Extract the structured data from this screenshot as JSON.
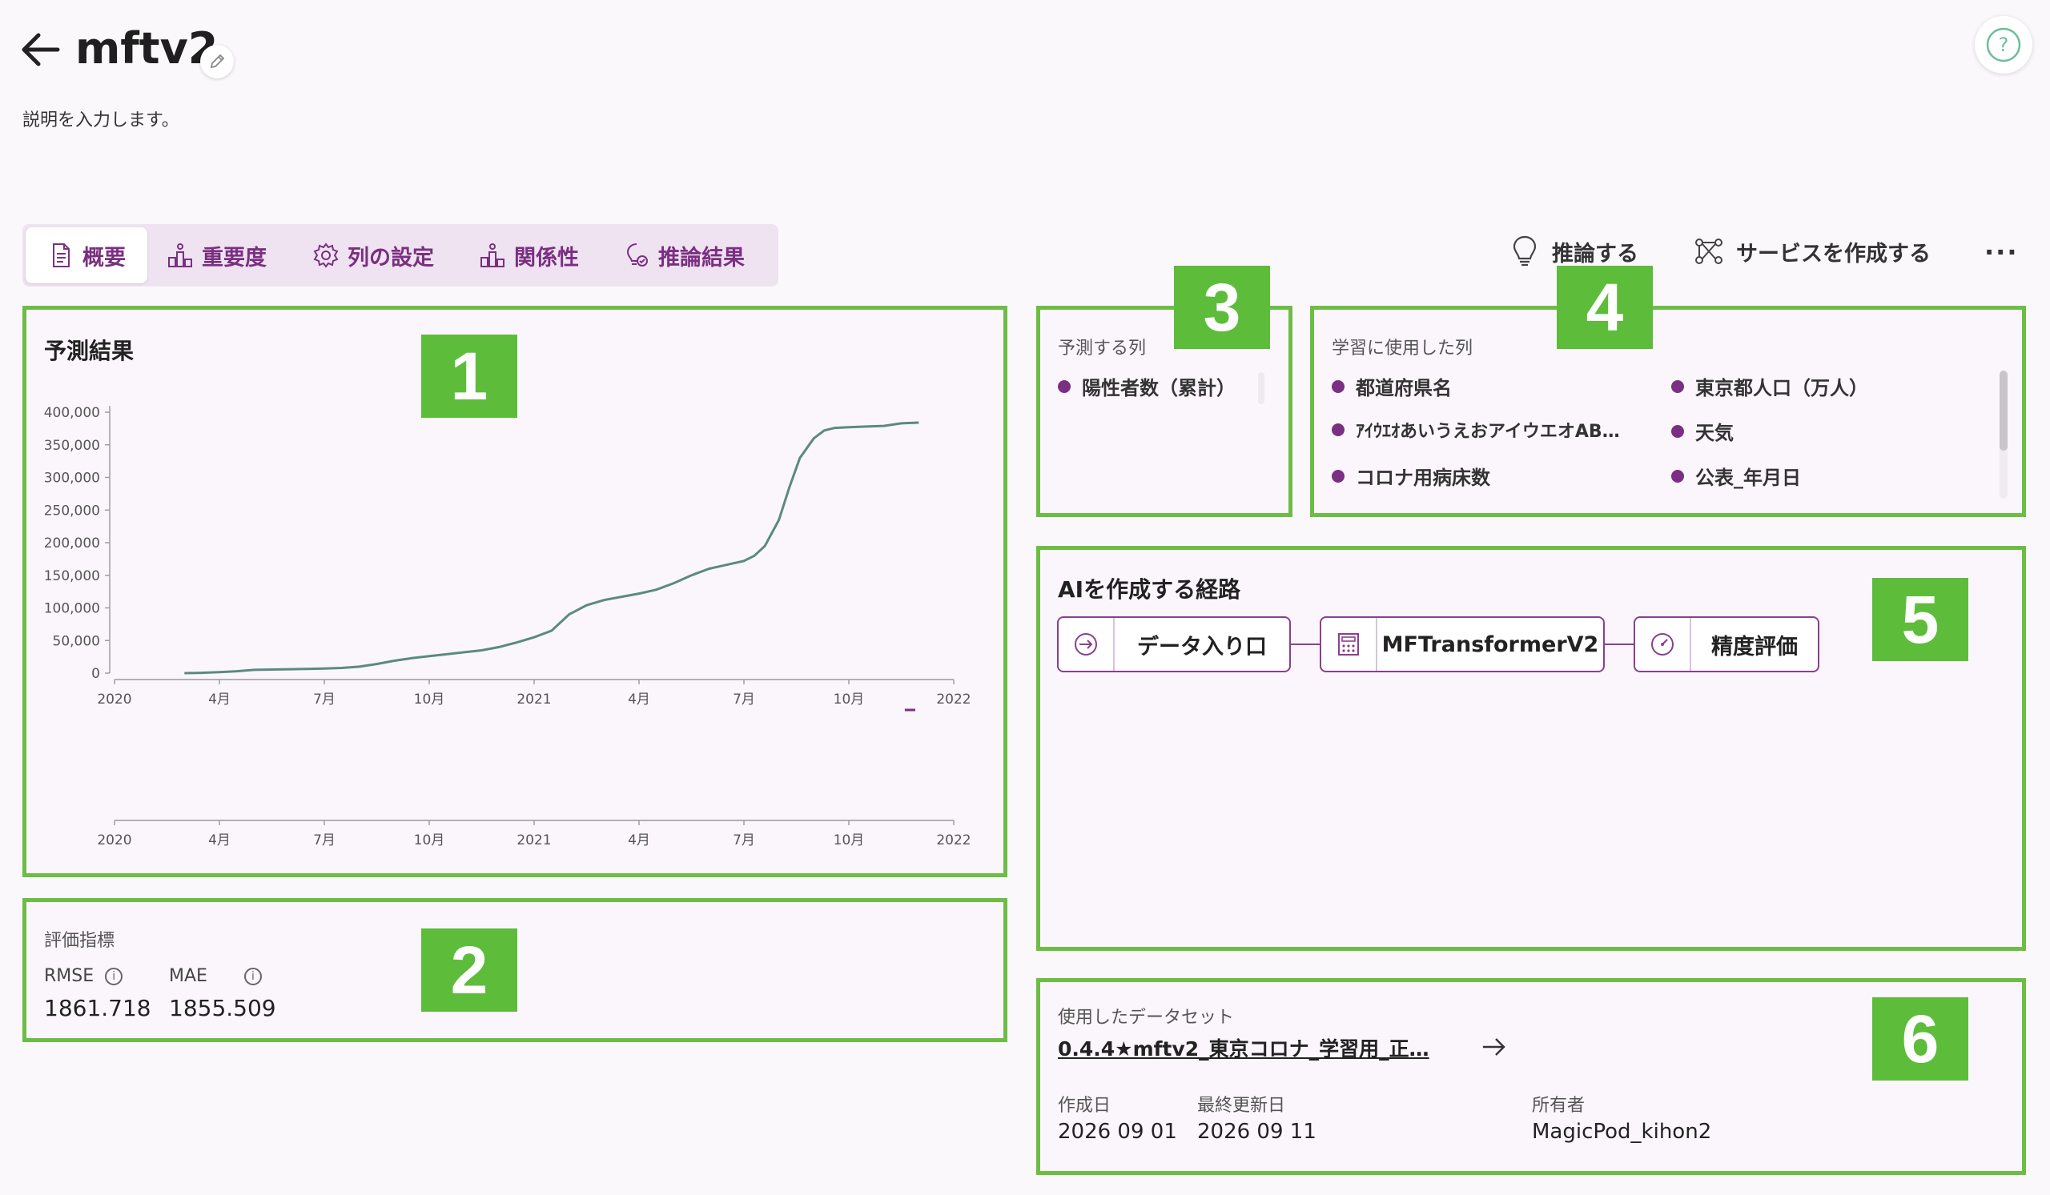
{
  "header": {
    "title": "mftv2",
    "description": "説明を入力します。"
  },
  "tabs": [
    {
      "label": "概要",
      "icon": "document-icon",
      "active": true
    },
    {
      "label": "重要度",
      "icon": "importance-icon"
    },
    {
      "label": "列の設定",
      "icon": "gear-icon"
    },
    {
      "label": "関係性",
      "icon": "relation-icon"
    },
    {
      "label": "推論結果",
      "icon": "inference-result-icon"
    }
  ],
  "actions": {
    "infer": "推論する",
    "create_service": "サービスを作成する"
  },
  "prediction": {
    "title": "予測結果",
    "chart_data": {
      "type": "line",
      "title": "",
      "x_ticks": [
        "2020",
        "4月",
        "7月",
        "10月",
        "2021",
        "4月",
        "7月",
        "10月",
        "2022"
      ],
      "y_ticks": [
        "400,000",
        "350,000",
        "300,000",
        "250,000",
        "200,000",
        "150,000",
        "100,000",
        "50,000",
        "0"
      ],
      "ylim": [
        0,
        400000
      ],
      "x_unit": "months since Jan 2020",
      "series": [
        {
          "x": [
            2.0,
            2.5,
            3.0,
            3.5,
            4.0,
            5.0,
            5.5,
            6.0,
            6.5,
            7.0,
            7.5,
            8.0,
            8.5,
            9.0,
            9.5,
            10.0,
            10.5,
            11.0,
            11.5,
            12.0,
            12.5,
            13.0,
            13.5,
            14.0,
            14.5,
            15.0,
            15.5,
            16.0,
            16.5,
            17.0,
            17.5,
            18.0,
            18.3,
            18.6,
            19.0,
            19.3,
            19.6,
            20.0,
            20.3,
            20.6,
            21.0,
            21.5,
            22.0,
            22.5,
            23.0
          ],
          "y": [
            0,
            500,
            1500,
            3000,
            5000,
            6000,
            6500,
            7000,
            8000,
            10000,
            14000,
            19000,
            23000,
            26000,
            29000,
            32000,
            35000,
            40000,
            47000,
            55000,
            65000,
            90000,
            104000,
            112000,
            117000,
            122000,
            128000,
            138000,
            150000,
            160000,
            166000,
            172000,
            180000,
            195000,
            235000,
            285000,
            330000,
            360000,
            372000,
            376000,
            377000,
            378000,
            379000,
            383000,
            384000
          ]
        }
      ]
    },
    "sub_x_ticks": [
      "2020",
      "4月",
      "7月",
      "10月",
      "2021",
      "4月",
      "7月",
      "10月",
      "2022"
    ]
  },
  "metrics": {
    "title": "評価指標",
    "items": [
      {
        "name": "RMSE",
        "value": "1861.718"
      },
      {
        "name": "MAE",
        "value": "1855.509"
      }
    ]
  },
  "target_columns": {
    "title": "予測する列",
    "items": [
      "陽性者数（累計）"
    ]
  },
  "training_columns": {
    "title": "学習に使用した列",
    "items": [
      "都道府県名",
      "東京都人口（万人）",
      "ｱｲｳｴｵあいうえおアイウエオAB…",
      "天気",
      "コロナ用病床数",
      "公表_年月日"
    ]
  },
  "pipeline": {
    "title": "AIを作成する経路",
    "nodes": [
      {
        "label": "データ入り口",
        "icon": "input-arrow-icon"
      },
      {
        "label": "MFTransformerV2",
        "icon": "calculator-icon"
      },
      {
        "label": "精度評価",
        "icon": "gauge-icon"
      }
    ]
  },
  "dataset": {
    "label": "使用したデータセット",
    "name": "0.4.4★mftv2_東京コロナ_学習用_正…",
    "created_label": "作成日",
    "created": "2026 09 01",
    "updated_label": "最終更新日",
    "updated": "2026 09 11",
    "owner_label": "所有者",
    "owner": "MagicPod_kihon2"
  },
  "badges": [
    "1",
    "2",
    "3",
    "4",
    "5",
    "6"
  ],
  "colors": {
    "accent": "#7b2f82",
    "highlight_border": "#6dbd45",
    "badge": "#5ebc3b",
    "line": "#5a8a82"
  }
}
